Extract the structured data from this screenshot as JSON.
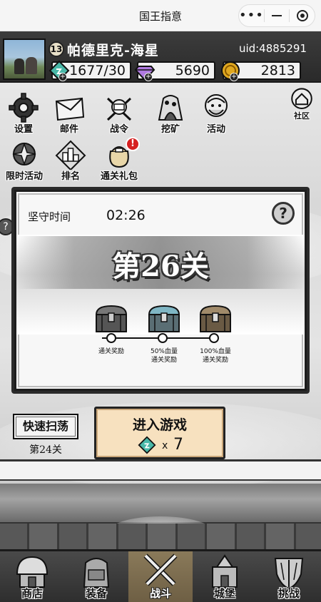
{
  "miniprogram": {
    "title": "国王指意"
  },
  "player": {
    "name": "帕德里克-海星",
    "level": "13",
    "uid": "uid:4885291"
  },
  "resources": {
    "energy": "1677/30",
    "gems": "5690",
    "gold": "2813"
  },
  "menu": {
    "row1": [
      {
        "label": "设置",
        "icon": "gear-icon"
      },
      {
        "label": "邮件",
        "icon": "mail-icon"
      },
      {
        "label": "战令",
        "icon": "battle-pass-icon"
      },
      {
        "label": "挖矿",
        "icon": "mining-icon"
      },
      {
        "label": "活动",
        "icon": "event-icon"
      }
    ],
    "community": {
      "label": "社区",
      "icon": "home-icon"
    },
    "row2": [
      {
        "label": "限时活动",
        "icon": "limited-event-icon"
      },
      {
        "label": "排名",
        "icon": "ranking-icon"
      },
      {
        "label": "通关礼包",
        "icon": "gift-bag-icon",
        "badge": "!"
      }
    ]
  },
  "stage": {
    "hold_label": "坚守时间",
    "hold_time": "02:26",
    "title": "第26关",
    "help": "?",
    "rewards": [
      {
        "label_lines": [
          "通关奖励"
        ]
      },
      {
        "label_lines": [
          "50%血量",
          "通关奖励"
        ]
      },
      {
        "label_lines": [
          "100%血量",
          "通关奖励"
        ]
      }
    ]
  },
  "actions": {
    "sweep_label": "快速扫荡",
    "sweep_stage": "第24关",
    "enter_label": "进入游戏",
    "enter_cost_x": "x",
    "enter_cost": "7"
  },
  "nav": [
    {
      "label": "商店",
      "icon": "shop-icon"
    },
    {
      "label": "装备",
      "icon": "backpack-icon"
    },
    {
      "label": "战斗",
      "icon": "crossed-swords-icon",
      "active": true
    },
    {
      "label": "城堡",
      "icon": "castle-icon"
    },
    {
      "label": "挑战",
      "icon": "challenge-shield-icon"
    }
  ],
  "colors": {
    "header_bg": "#2f2f2f",
    "enter_button": "#f7e1bf",
    "badge_red": "#d62020",
    "active_tab": "#7c6c4e"
  }
}
